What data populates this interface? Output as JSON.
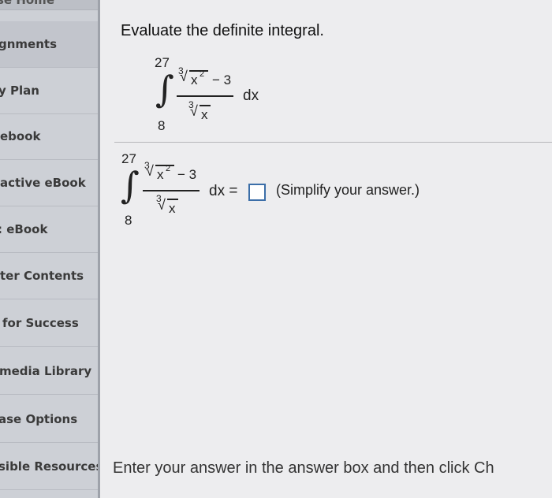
{
  "sidebar": {
    "top_label": "se Home",
    "items": [
      {
        "label": "gnments"
      },
      {
        "label": "y Plan"
      },
      {
        "label": "ebook"
      },
      {
        "label": "active eBook"
      },
      {
        "label": ": eBook"
      },
      {
        "label": "ter Contents"
      },
      {
        "label": "for Success"
      },
      {
        "label": "media Library"
      },
      {
        "label": "ase Options"
      },
      {
        "label": "sible Resources"
      }
    ]
  },
  "question": {
    "title": "Evaluate the definite integral.",
    "upper_limit": "27",
    "lower_limit": "8",
    "numerator_index": "3",
    "numerator_radicand": "x",
    "numerator_exponent": "2",
    "numerator_minus": "− 3",
    "denominator_index": "3",
    "denominator_radicand": "x",
    "differential": "dx"
  },
  "answer_row": {
    "upper_limit": "27",
    "lower_limit": "8",
    "differential_equals": "dx =",
    "answer_value": "",
    "hint": "(Simplify your answer.)"
  },
  "footer": {
    "instruction": "Enter your answer in the answer box and then click Ch"
  }
}
